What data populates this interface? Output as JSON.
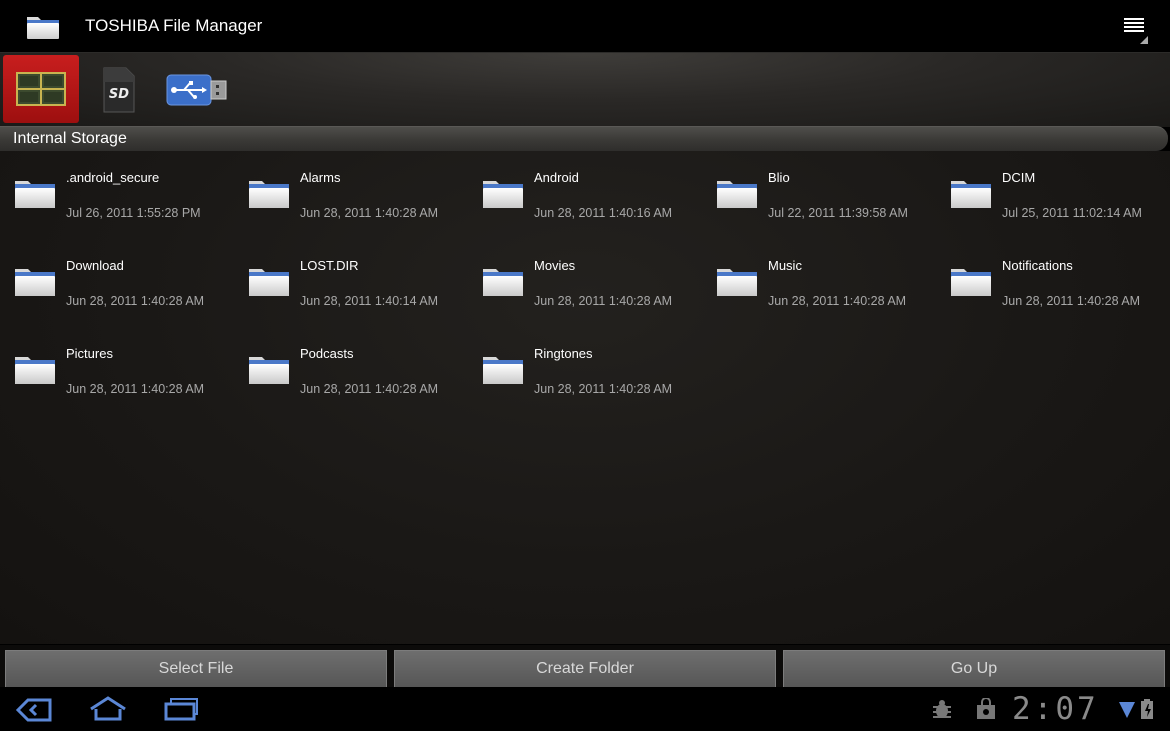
{
  "app": {
    "title": "TOSHIBA File Manager"
  },
  "section": {
    "title": "Internal Storage"
  },
  "storage_sources": [
    {
      "name": "Internal Storage",
      "icon": "memory-chip-icon",
      "selected": true
    },
    {
      "name": "SD Card",
      "icon": "sd-card-icon",
      "selected": false
    },
    {
      "name": "USB Storage",
      "icon": "usb-drive-icon",
      "selected": false
    }
  ],
  "files": [
    {
      "name": ".android_secure",
      "date": "Jul 26, 2011 1:55:28 PM"
    },
    {
      "name": "Alarms",
      "date": "Jun 28, 2011 1:40:28 AM"
    },
    {
      "name": "Android",
      "date": "Jun 28, 2011 1:40:16 AM"
    },
    {
      "name": "Blio",
      "date": "Jul 22, 2011 11:39:58 AM"
    },
    {
      "name": "DCIM",
      "date": "Jul 25, 2011 11:02:14 AM"
    },
    {
      "name": "Download",
      "date": "Jun 28, 2011 1:40:28 AM"
    },
    {
      "name": "LOST.DIR",
      "date": "Jun 28, 2011 1:40:14 AM"
    },
    {
      "name": "Movies",
      "date": "Jun 28, 2011 1:40:28 AM"
    },
    {
      "name": "Music",
      "date": "Jun 28, 2011 1:40:28 AM"
    },
    {
      "name": "Notifications",
      "date": "Jun 28, 2011 1:40:28 AM"
    },
    {
      "name": "Pictures",
      "date": "Jun 28, 2011 1:40:28 AM"
    },
    {
      "name": "Podcasts",
      "date": "Jun 28, 2011 1:40:28 AM"
    },
    {
      "name": "Ringtones",
      "date": "Jun 28, 2011 1:40:28 AM"
    }
  ],
  "buttons": {
    "select_file": "Select File",
    "create_folder": "Create Folder",
    "go_up": "Go Up"
  },
  "system_bar": {
    "clock": "2:07",
    "accent_color": "#5b87d6"
  }
}
